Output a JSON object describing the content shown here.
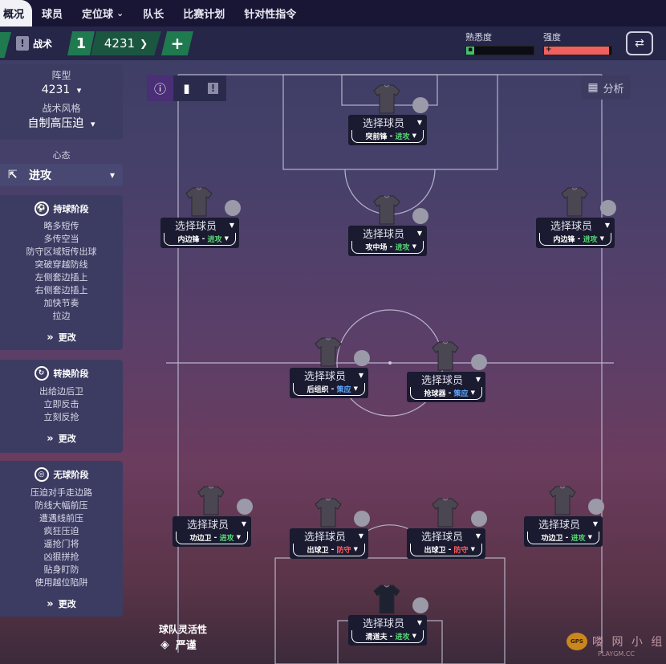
{
  "nav": {
    "items": [
      "概况",
      "球员",
      "定位球",
      "队长",
      "比赛计划",
      "针对性指令"
    ],
    "dropdown_marker": "⌄"
  },
  "tactics_bar": {
    "tactics_label": "战术",
    "slot_number": "1",
    "formation_name": "4231",
    "add_label": "+",
    "familiarity_label": "熟悉度",
    "intensity_label": "强度",
    "familiarity_fraction": 0.12,
    "intensity_fraction": 0.96,
    "familiarity_color": "#3fc26a",
    "intensity_color": "#f0605e"
  },
  "sidebar": {
    "formation_label": "阵型",
    "formation_value": "4231",
    "style_label": "战术风格",
    "style_value": "自制高压迫",
    "mentality_label": "心态",
    "mentality_value": "进攻",
    "in_possession": {
      "title": "持球阶段",
      "instructions": [
        "略多短传",
        "多传空当",
        "防守区域短传出球",
        "突破穿越防线",
        "左侧套边插上",
        "右侧套边插上",
        "加快节奏",
        "拉边"
      ],
      "change_label": "更改"
    },
    "transition": {
      "title": "转换阶段",
      "instructions": [
        "出给边后卫",
        "立即反击",
        "立刻反抢"
      ],
      "change_label": "更改"
    },
    "out_of_possession": {
      "title": "无球阶段",
      "instructions": [
        "压迫对手走边路",
        "防线大幅前压",
        "遭遇线前压",
        "疯狂压迫",
        "逼抢门将",
        "凶狠拼抢",
        "贴身盯防",
        "使用越位陷阱"
      ],
      "change_label": "更改"
    }
  },
  "pitch": {
    "analysis_label": "分析",
    "fluidity_label": "球队灵活性",
    "fluidity_value": "严谨",
    "select_player": "选择球员",
    "players": [
      {
        "role": "突前锋",
        "duty": "进攻",
        "color": "red"
      },
      {
        "role": "内边锋",
        "duty": "进攻",
        "color": "green"
      },
      {
        "role": "攻中场",
        "duty": "进攻",
        "color": "green"
      },
      {
        "role": "内边锋",
        "duty": "进攻",
        "color": "green"
      },
      {
        "role": "后组织",
        "duty": "策应",
        "color": "green"
      },
      {
        "role": "抢球器",
        "duty": "策应",
        "color": "green"
      },
      {
        "role": "功边卫",
        "duty": "进攻",
        "color": "blue"
      },
      {
        "role": "出球卫",
        "duty": "防守",
        "color": "blue"
      },
      {
        "role": "出球卫",
        "duty": "防守",
        "color": "blue"
      },
      {
        "role": "功边卫",
        "duty": "进攻",
        "color": "blue"
      },
      {
        "role": "清道夫",
        "duty": "进攻",
        "color": "purple"
      }
    ]
  },
  "watermark": {
    "text": "喽 网 小 组",
    "sub": "PLAYGM.CC",
    "badge": "GPS"
  }
}
